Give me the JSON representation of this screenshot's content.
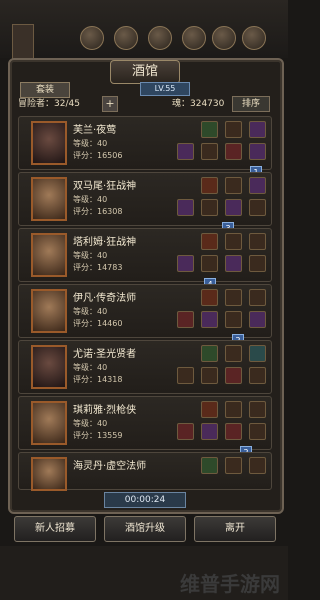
{
  "header": {
    "title": "酒馆",
    "level": "LV.55",
    "tab_label": "套装",
    "adventurers_label": "冒险者：32/45",
    "soul_label": "魂：324730",
    "sort_label": "排序",
    "plus_label": "+"
  },
  "heroes": [
    {
      "name": "芙兰·夜莺",
      "level": "等级：40",
      "score": "评分：16506",
      "dark": true
    },
    {
      "name": "双马尾·狂战神",
      "level": "等级：40",
      "score": "评分：16308",
      "dark": false
    },
    {
      "name": "塔利姆·狂战神",
      "level": "等级：40",
      "score": "评分：14783",
      "dark": false
    },
    {
      "name": "伊凡·传奇法师",
      "level": "等级：40",
      "score": "评分：14460",
      "dark": false
    },
    {
      "name": "尤诺·圣光贤者",
      "level": "等级：40",
      "score": "评分：14318",
      "dark": true
    },
    {
      "name": "琪莉雅·烈枪侠",
      "level": "等级：40",
      "score": "评分：13559",
      "dark": false
    },
    {
      "name": "海灵丹·虚空法师",
      "level": "",
      "score": "",
      "dark": false
    }
  ],
  "badges": [
    "1",
    "3",
    "4",
    "2",
    "2"
  ],
  "timer": "00:00:24",
  "buttons": {
    "recruit": "新人招募",
    "upgrade": "酒馆升级",
    "leave": "离开"
  },
  "watermark": "维普手游网"
}
